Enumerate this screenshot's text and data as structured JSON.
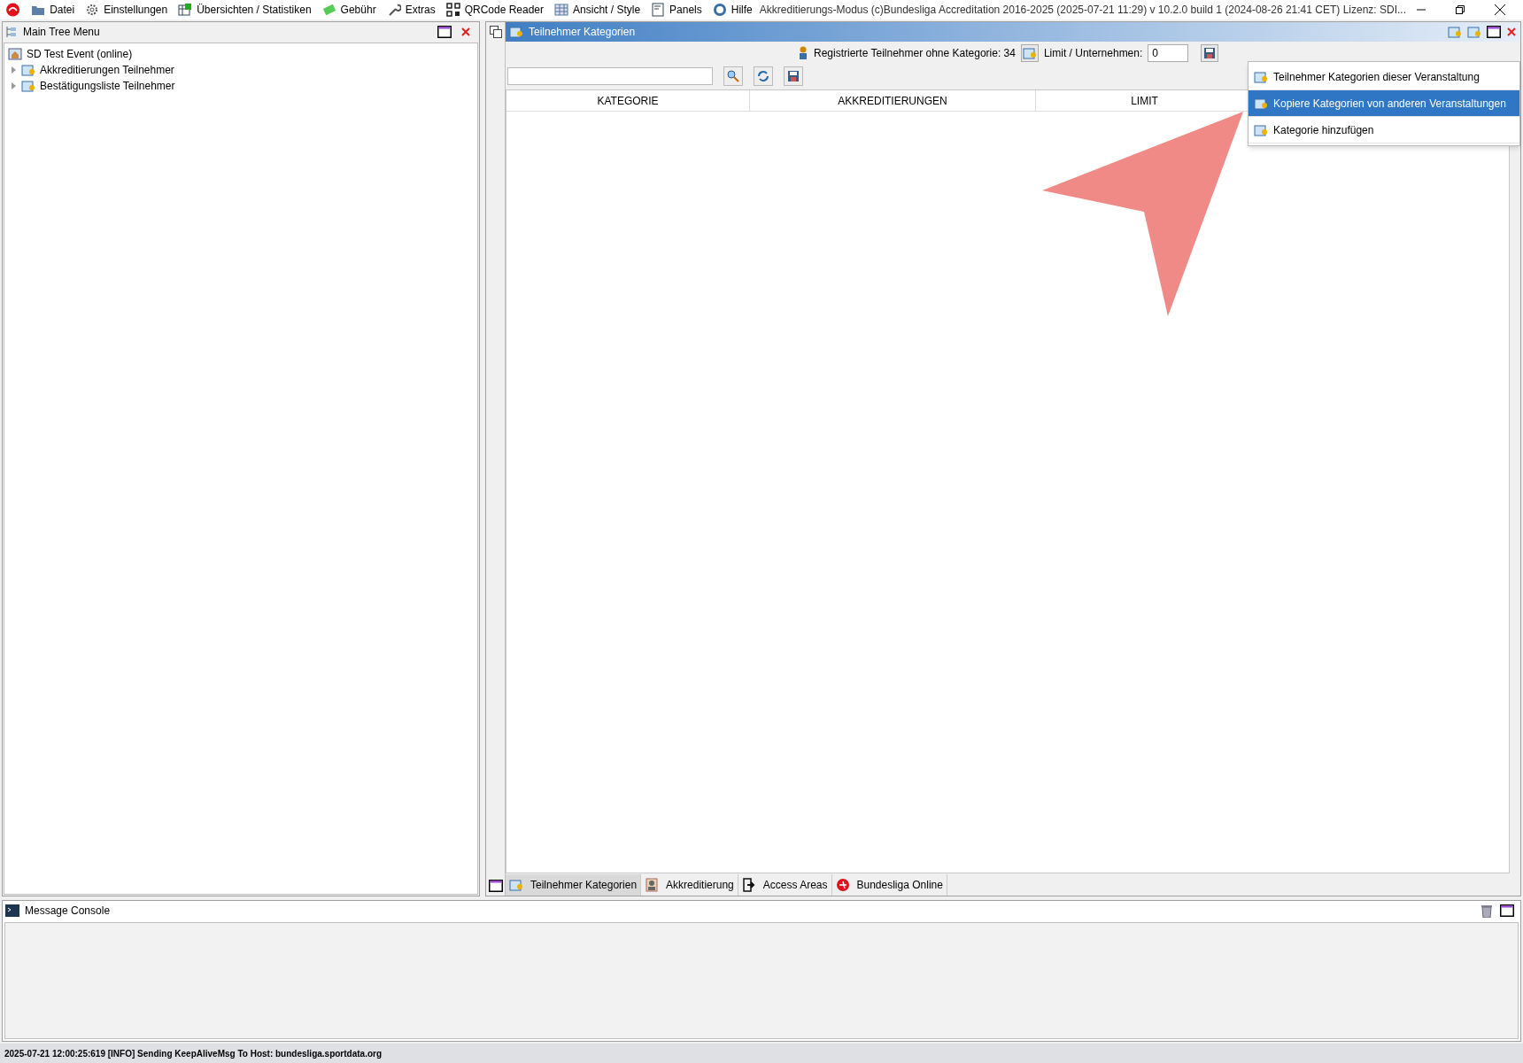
{
  "menu_bar": {
    "items": [
      {
        "label": "Datei"
      },
      {
        "label": "Einstellungen"
      },
      {
        "label": "Übersichten / Statistiken"
      },
      {
        "label": "Gebühr"
      },
      {
        "label": "Extras"
      },
      {
        "label": "QRCode Reader"
      },
      {
        "label": "Ansicht / Style"
      },
      {
        "label": "Panels"
      },
      {
        "label": "Hilfe"
      }
    ],
    "title": "Akkreditierungs-Modus (c)Bundesliga Accreditation 2016-2025 (2025-07-21 11:29) v 10.2.0 build 1 (2024-08-26 21:41 CET) Lizenz: SDI..."
  },
  "tree_panel": {
    "title": "Main Tree Menu",
    "root": {
      "label": "SD Test Event (online)",
      "children": [
        {
          "label": "Akkreditierungen Teilnehmer",
          "expanded": false
        },
        {
          "label": "Bestätigungsliste Teilnehmer",
          "expanded": false
        }
      ]
    }
  },
  "content_panel": {
    "title": "Teilnehmer Kategorien",
    "info": "Registrierte Teilnehmer ohne Kategorie: 34",
    "limit_label": "Limit / Unternehmen:",
    "limit_value": "0",
    "table": {
      "columns": [
        "KATEGORIE",
        "AKKREDITIERUNGEN",
        "LIMIT"
      ]
    },
    "context_menu": [
      {
        "label": "Teilnehmer Kategorien dieser Veranstaltung",
        "selected": false
      },
      {
        "label": "Kopiere Kategorien von anderen Veranstaltungen",
        "selected": true
      },
      {
        "label": "Kategorie hinzufügen",
        "selected": false
      }
    ],
    "tabs": [
      {
        "label": "Teilnehmer Kategorien",
        "selected": true
      },
      {
        "label": "Akkreditierung",
        "selected": false
      },
      {
        "label": "Access Areas",
        "selected": false
      },
      {
        "label": "Bundesliga Online",
        "selected": false
      }
    ]
  },
  "console": {
    "title": "Message Console"
  },
  "status_bar": "2025-07-21 12:00:25:619 [INFO] Sending KeepAliveMsg To Host: bundesliga.sportdata.org"
}
